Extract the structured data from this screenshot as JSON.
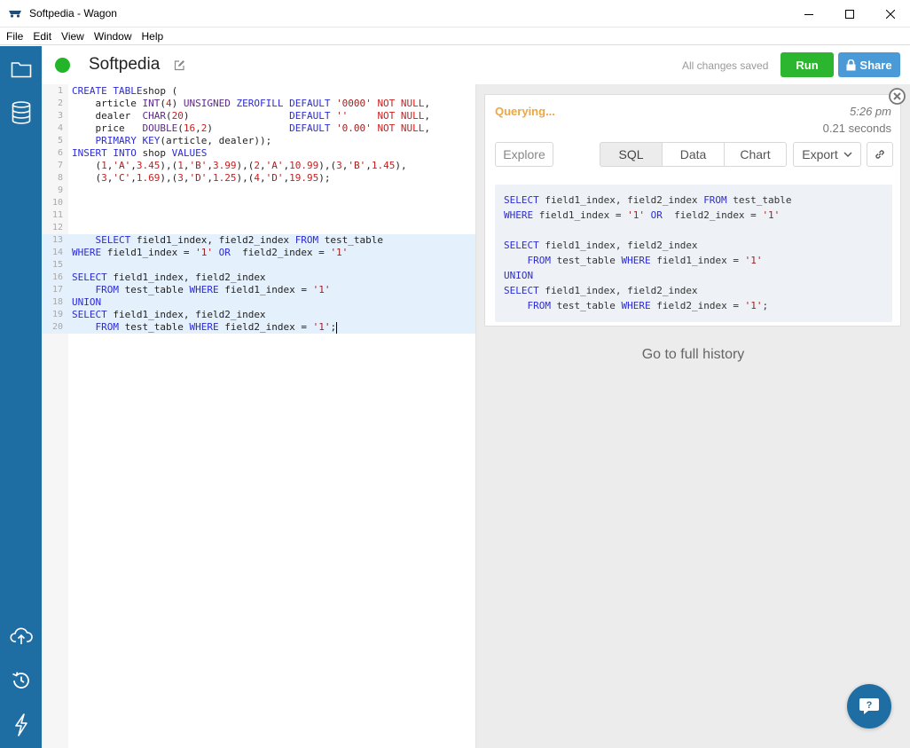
{
  "window": {
    "title": "Softpedia - Wagon"
  },
  "menu": [
    "File",
    "Edit",
    "View",
    "Window",
    "Help"
  ],
  "sidebar": {
    "icons": [
      "folder-icon",
      "database-icon",
      "cloud-upload-icon",
      "history-icon",
      "lightning-icon"
    ]
  },
  "header": {
    "title": "Softpedia",
    "saved_status": "All changes saved",
    "run_label": "Run",
    "share_label": "Share",
    "status_color": "#23b42a"
  },
  "editor": {
    "lines": [
      {
        "n": "1",
        "segments": [
          [
            "kw",
            "CREATE TABLE"
          ],
          [
            "",
            "shop ("
          ]
        ]
      },
      {
        "n": "2",
        "segments": [
          [
            "",
            "    article "
          ],
          [
            "ty",
            "INT"
          ],
          [
            "",
            "("
          ],
          [
            "nl",
            "4"
          ],
          [
            "",
            ") "
          ],
          [
            "ty",
            "UNSIGNED"
          ],
          [
            "",
            " "
          ],
          [
            "kw",
            "ZEROFILL"
          ],
          [
            "",
            " "
          ],
          [
            "kw",
            "DEFAULT"
          ],
          [
            "",
            " "
          ],
          [
            "str",
            "'0000'"
          ],
          [
            "",
            " "
          ],
          [
            "nl",
            "NOT NULL"
          ],
          [
            "",
            ","
          ]
        ]
      },
      {
        "n": "3",
        "segments": [
          [
            "",
            "    dealer  "
          ],
          [
            "ty",
            "CHAR"
          ],
          [
            "",
            "("
          ],
          [
            "nl",
            "20"
          ],
          [
            ")",
            ""
          ],
          [
            "",
            "                 "
          ],
          [
            "kw",
            "DEFAULT"
          ],
          [
            "",
            " "
          ],
          [
            "str",
            "''"
          ],
          [
            "",
            "     "
          ],
          [
            "nl",
            "NOT NULL"
          ],
          [
            "",
            ","
          ]
        ]
      },
      {
        "n": "4",
        "segments": [
          [
            "",
            "    price   "
          ],
          [
            "ty",
            "DOUBLE"
          ],
          [
            "",
            "("
          ],
          [
            "nl",
            "16"
          ],
          [
            "",
            ","
          ],
          [
            "nl",
            "2"
          ],
          [
            "",
            ")             "
          ],
          [
            "kw",
            "DEFAULT"
          ],
          [
            "",
            " "
          ],
          [
            "str",
            "'0.00'"
          ],
          [
            "",
            " "
          ],
          [
            "nl",
            "NOT NULL"
          ],
          [
            "",
            ","
          ]
        ]
      },
      {
        "n": "5",
        "segments": [
          [
            "",
            "    "
          ],
          [
            "kw",
            "PRIMARY KEY"
          ],
          [
            "",
            "(article, dealer));"
          ]
        ]
      },
      {
        "n": "6",
        "segments": [
          [
            "kw",
            "INSERT INTO"
          ],
          [
            "",
            " shop "
          ],
          [
            "kw",
            "VALUES"
          ]
        ]
      },
      {
        "n": "7",
        "segments": [
          [
            "",
            "    ("
          ],
          [
            "nl",
            "1"
          ],
          [
            "",
            ","
          ],
          [
            "str",
            "'A'"
          ],
          [
            "",
            ","
          ],
          [
            "nl",
            "3.45"
          ],
          [
            "",
            "),("
          ],
          [
            "nl",
            "1"
          ],
          [
            "",
            ","
          ],
          [
            "str",
            "'B'"
          ],
          [
            "",
            ","
          ],
          [
            "nl",
            "3.99"
          ],
          [
            "",
            "),("
          ],
          [
            "nl",
            "2"
          ],
          [
            "",
            ","
          ],
          [
            "str",
            "'A'"
          ],
          [
            "",
            ","
          ],
          [
            "nl",
            "10.99"
          ],
          [
            "",
            "),("
          ],
          [
            "nl",
            "3"
          ],
          [
            "",
            ","
          ],
          [
            "str",
            "'B'"
          ],
          [
            "",
            ","
          ],
          [
            "nl",
            "1.45"
          ],
          [
            "",
            "),"
          ]
        ]
      },
      {
        "n": "8",
        "segments": [
          [
            "",
            "    ("
          ],
          [
            "nl",
            "3"
          ],
          [
            "",
            ","
          ],
          [
            "str",
            "'C'"
          ],
          [
            "",
            ","
          ],
          [
            "nl",
            "1.69"
          ],
          [
            "",
            "),("
          ],
          [
            "nl",
            "3"
          ],
          [
            "",
            ","
          ],
          [
            "str",
            "'D'"
          ],
          [
            "",
            ","
          ],
          [
            "nl",
            "1.25"
          ],
          [
            "",
            "),("
          ],
          [
            "nl",
            "4"
          ],
          [
            "",
            ","
          ],
          [
            "str",
            "'D'"
          ],
          [
            "",
            ","
          ],
          [
            "nl",
            "19.95"
          ],
          [
            "",
            ");"
          ]
        ]
      },
      {
        "n": "9",
        "segments": []
      },
      {
        "n": "10",
        "segments": []
      },
      {
        "n": "11",
        "segments": []
      },
      {
        "n": "12",
        "segments": []
      },
      {
        "n": "13",
        "sel": true,
        "segments": [
          [
            "",
            "    "
          ],
          [
            "kw",
            "SELECT"
          ],
          [
            "",
            " field1_index, field2_index "
          ],
          [
            "kw",
            "FROM"
          ],
          [
            "",
            " test_table"
          ]
        ]
      },
      {
        "n": "14",
        "sel": true,
        "segments": [
          [
            "kw",
            "WHERE"
          ],
          [
            "",
            " field1_index = "
          ],
          [
            "str",
            "'1'"
          ],
          [
            "",
            " "
          ],
          [
            "kw",
            "OR"
          ],
          [
            "",
            "  field2_index = "
          ],
          [
            "str",
            "'1'"
          ]
        ]
      },
      {
        "n": "15",
        "sel": true,
        "segments": []
      },
      {
        "n": "16",
        "sel": true,
        "segments": [
          [
            "kw",
            "SELECT"
          ],
          [
            "",
            " field1_index, field2_index"
          ]
        ]
      },
      {
        "n": "17",
        "sel": true,
        "segments": [
          [
            "",
            "    "
          ],
          [
            "kw",
            "FROM"
          ],
          [
            "",
            " test_table "
          ],
          [
            "kw",
            "WHERE"
          ],
          [
            "",
            " field1_index = "
          ],
          [
            "str",
            "'1'"
          ]
        ]
      },
      {
        "n": "18",
        "sel": true,
        "segments": [
          [
            "kw",
            "UNION"
          ]
        ]
      },
      {
        "n": "19",
        "sel": true,
        "segments": [
          [
            "kw",
            "SELECT"
          ],
          [
            "",
            " field1_index, field2_index"
          ]
        ]
      },
      {
        "n": "20",
        "sel": true,
        "cursor": true,
        "segments": [
          [
            "",
            "    "
          ],
          [
            "kw",
            "FROM"
          ],
          [
            "",
            " test_table "
          ],
          [
            "kw",
            "WHERE"
          ],
          [
            "",
            " field2_index = "
          ],
          [
            "str",
            "'1'"
          ],
          [
            "",
            ";"
          ]
        ]
      }
    ]
  },
  "result": {
    "status": "Querying...",
    "time": "5:26 pm",
    "duration": "0.21 seconds",
    "tabs": {
      "explore": "Explore",
      "sql": "SQL",
      "data": "Data",
      "chart": "Chart",
      "export": "Export"
    },
    "sql_lines": [
      [
        [
          "kw",
          "SELECT"
        ],
        [
          "",
          " field1_index, field2_index "
        ],
        [
          "kw",
          "FROM"
        ],
        [
          "",
          " test_table"
        ]
      ],
      [
        [
          "kw",
          "WHERE"
        ],
        [
          "",
          " field1_index = "
        ],
        [
          "str",
          "'1'"
        ],
        [
          "",
          " "
        ],
        [
          "kw",
          "OR"
        ],
        [
          "",
          "  field2_index = "
        ],
        [
          "str",
          "'1'"
        ]
      ],
      [],
      [
        [
          "kw",
          "SELECT"
        ],
        [
          "",
          " field1_index, field2_index"
        ]
      ],
      [
        [
          "",
          "    "
        ],
        [
          "kw",
          "FROM"
        ],
        [
          "",
          " test_table "
        ],
        [
          "kw",
          "WHERE"
        ],
        [
          "",
          " field1_index = "
        ],
        [
          "str",
          "'1'"
        ]
      ],
      [
        [
          "kw",
          "UNION"
        ]
      ],
      [
        [
          "kw",
          "SELECT"
        ],
        [
          "",
          " field1_index, field2_index"
        ]
      ],
      [
        [
          "",
          "    "
        ],
        [
          "kw",
          "FROM"
        ],
        [
          "",
          " test_table "
        ],
        [
          "kw",
          "WHERE"
        ],
        [
          "",
          " field2_index = "
        ],
        [
          "str",
          "'1'"
        ],
        [
          "",
          ";"
        ]
      ]
    ]
  },
  "history": {
    "label": "Go to full history"
  },
  "colors": {
    "sidebar": "#1f6ea3",
    "run": "#2cb52e",
    "share": "#4a9ad8",
    "querying": "#f0a640"
  }
}
